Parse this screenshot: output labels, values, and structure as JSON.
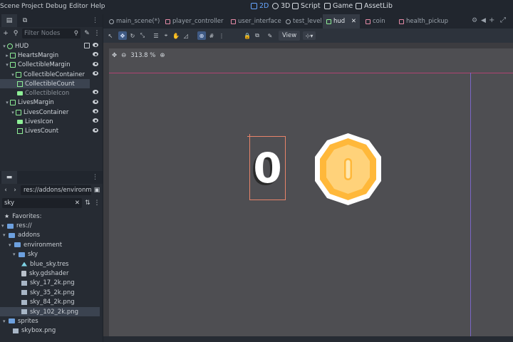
{
  "menu": [
    "Scene",
    "Project",
    "Debug",
    "Editor",
    "Help"
  ],
  "workspaces": [
    {
      "label": "2D",
      "active": true
    },
    {
      "label": "3D",
      "active": false
    },
    {
      "label": "Script",
      "active": false
    },
    {
      "label": "Game",
      "active": false
    },
    {
      "label": "AssetLib",
      "active": false
    }
  ],
  "scene_dock": {
    "filter_placeholder": "Filter Nodes",
    "tree": [
      {
        "label": "HUD",
        "depth": 0,
        "icon": "control-icon",
        "expanded": true
      },
      {
        "label": "HeartsMargin",
        "depth": 1,
        "icon": "control-icon",
        "expanded": false
      },
      {
        "label": "CollectibleMargin",
        "depth": 1,
        "icon": "control-icon",
        "expanded": true
      },
      {
        "label": "CollectibleContainer",
        "depth": 2,
        "icon": "container-icon",
        "expanded": true
      },
      {
        "label": "CollectibleCount",
        "depth": 3,
        "icon": "label-icon",
        "selected": true
      },
      {
        "label": "CollectibleIcon",
        "depth": 3,
        "icon": "texture-rect-icon",
        "dim": true
      },
      {
        "label": "LivesMargin",
        "depth": 1,
        "icon": "control-icon",
        "expanded": true
      },
      {
        "label": "LivesContainer",
        "depth": 2,
        "icon": "container-icon",
        "expanded": true
      },
      {
        "label": "LivesIcon",
        "depth": 3,
        "icon": "texture-rect-icon"
      },
      {
        "label": "LivesCount",
        "depth": 3,
        "icon": "label-icon"
      }
    ]
  },
  "fs_dock": {
    "path": "res://addons/environment",
    "search": "sky",
    "items": [
      {
        "label": "Favorites:",
        "depth": 0,
        "kind": "star"
      },
      {
        "label": "res://",
        "depth": 0,
        "kind": "folder"
      },
      {
        "label": "addons",
        "depth": 1,
        "kind": "folder"
      },
      {
        "label": "environment",
        "depth": 2,
        "kind": "folder"
      },
      {
        "label": "sky",
        "depth": 3,
        "kind": "folder"
      },
      {
        "label": "blue_sky.tres",
        "depth": 4,
        "kind": "tres"
      },
      {
        "label": "sky.gdshader",
        "depth": 4,
        "kind": "file"
      },
      {
        "label": "sky_17_2k.png",
        "depth": 4,
        "kind": "image"
      },
      {
        "label": "sky_35_2k.png",
        "depth": 4,
        "kind": "image"
      },
      {
        "label": "sky_84_2k.png",
        "depth": 4,
        "kind": "image"
      },
      {
        "label": "sky_102_2k.png",
        "depth": 4,
        "kind": "image",
        "selected": true
      },
      {
        "label": "sprites",
        "depth": 1,
        "kind": "folder"
      },
      {
        "label": "skybox.png",
        "depth": 2,
        "kind": "image"
      }
    ]
  },
  "editor_tabs": [
    {
      "label": "main_scene(*)",
      "icon": "node3d-icon"
    },
    {
      "label": "player_controller",
      "icon": "node2d-icon"
    },
    {
      "label": "user_interface",
      "icon": "node2d-icon"
    },
    {
      "label": "test_level",
      "icon": "node3d-icon"
    },
    {
      "label": "hud",
      "icon": "control-icon",
      "selected": true
    },
    {
      "label": "coin",
      "icon": "node2d-icon"
    },
    {
      "label": "health_pickup",
      "icon": "node2d-icon"
    }
  ],
  "toolbar": {
    "view_label": "View"
  },
  "viewport": {
    "zoom": "313.8 %",
    "collectible_count": "0"
  },
  "colors": {
    "accent": "#67a6ff",
    "selection_outline": "#e8846a",
    "coin_gold": "#ffb83a",
    "coin_light": "#ffd27a"
  }
}
